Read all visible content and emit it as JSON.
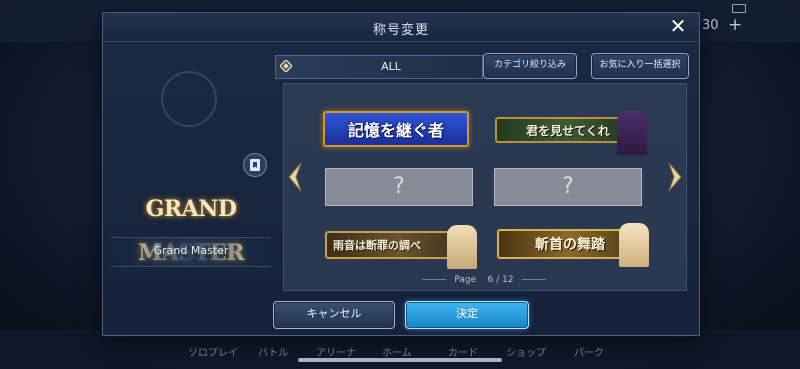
{
  "background": {
    "top_count": "30",
    "top_plus": "+",
    "nav": [
      "ソロプレイ",
      "バトル",
      "アリーナ",
      "ホーム",
      "カード",
      "ショップ",
      "パーク"
    ]
  },
  "dialog": {
    "title": "称号変更",
    "close_glyph": "✕",
    "current": {
      "logo_text": "GRAND MASTER",
      "name": "Grand Master"
    },
    "category": {
      "label": "ALL"
    },
    "buttons": {
      "filter": "カテゴリ絞り込み",
      "favorites": "お気に入り一括選択",
      "cancel": "キャンセル",
      "confirm": "決定"
    },
    "titles": [
      {
        "text": "記憶を継ぐ者"
      },
      {
        "text": "君を見せてくれ"
      },
      {
        "text": "?"
      },
      {
        "text": "?"
      },
      {
        "text": "雨音は断罪の調べ"
      },
      {
        "text": "斬首の舞踏"
      }
    ],
    "pager": {
      "label": "Page",
      "current": "6",
      "sep": "/",
      "total": "12"
    }
  },
  "colors": {
    "accent_blue": "#2a9ee0",
    "gold_border": "#c9993a",
    "panel_bg": "#1b2a42"
  }
}
